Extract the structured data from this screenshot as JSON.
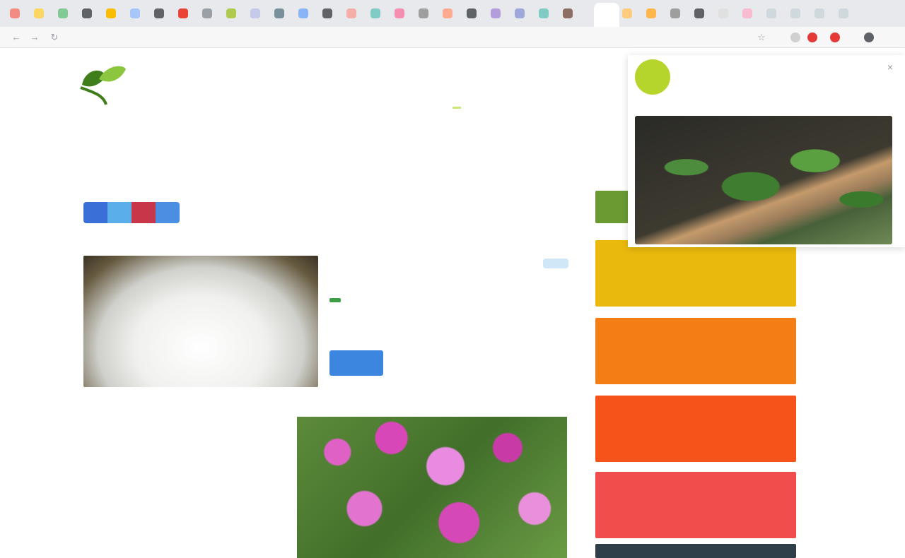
{
  "browser": {
    "url": "",
    "tab_colors": [
      "#f28b82",
      "#fdd663",
      "#81c995",
      "#5f6368",
      "#fbbc04",
      "#a7c7fa",
      "#5f6368",
      "#ea4335",
      "#9aa0a6",
      "#aecb4f",
      "#c5cae9",
      "#78909c",
      "#8ab4f8",
      "#5f6368",
      "#f6aea9",
      "#80cbc4",
      "#f48fb1",
      "#9e9e9e",
      "#ffab91",
      "#5f6368",
      "#b39ddb",
      "#9fa8da",
      "#80cbc4",
      "#8d6e63"
    ],
    "right_tab_colors": [
      "#ffcc80",
      "#ffb74d",
      "#9e9e9e",
      "#5f6368",
      "#e0e0e0",
      "#f8bbd0",
      "#cfd8dc",
      "#cfd8dc",
      "#cfd8dc",
      "#cfd8dc"
    ],
    "extension_colors": [
      "#d0d0d0",
      "#e53935",
      "#e53935",
      "#5f6368"
    ]
  },
  "site": {
    "logo_text": "",
    "logo_tld": "",
    "nav": [
      {
        "label": "",
        "active": true
      },
      {
        "label": "",
        "active": false
      },
      {
        "label": "",
        "active": false
      }
    ]
  },
  "article": {
    "title": "",
    "byline": "",
    "share_colors": [
      "#3b6fd8",
      "#5aaee9",
      "#c8364a",
      "#4b8fe2"
    ]
  },
  "product": {
    "name": "",
    "badge": "",
    "meta": "",
    "price": "",
    "button": "",
    "compare": ""
  },
  "toc": {
    "title": "",
    "items": [
      "",
      "",
      "",
      ""
    ]
  },
  "sidebar": {
    "heading": "",
    "categories": [
      {
        "label": "",
        "color": "#eab90d"
      },
      {
        "label": "",
        "color": "#f57d15"
      },
      {
        "label": "",
        "color": "#f5531a"
      },
      {
        "label": "",
        "color": "#f24d4d"
      },
      {
        "label": "",
        "color": "#2f3f4a"
      }
    ]
  },
  "popup": {
    "icon_text": "",
    "title": "",
    "text": "",
    "close": "×"
  }
}
